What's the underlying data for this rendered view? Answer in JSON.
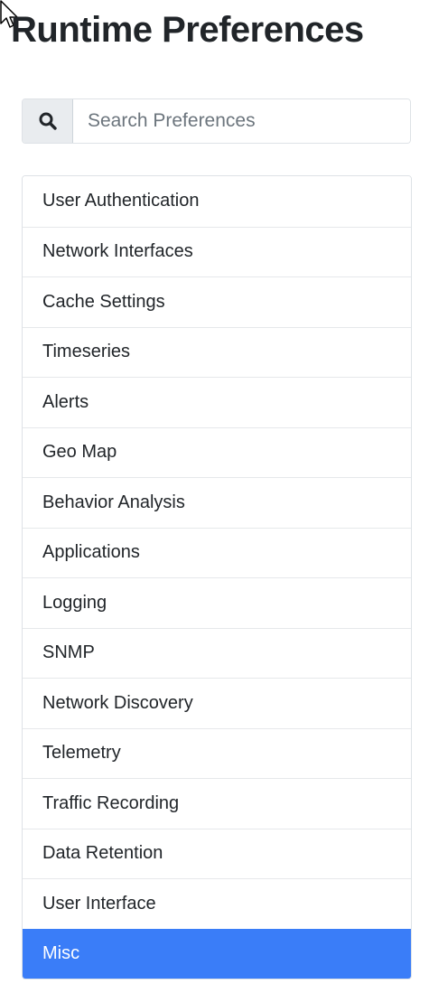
{
  "page": {
    "title": "Runtime Preferences"
  },
  "search": {
    "icon": "search-icon",
    "placeholder": "Search Preferences",
    "value": ""
  },
  "preferences": {
    "active_item": "Misc",
    "items": [
      {
        "label": "User Authentication"
      },
      {
        "label": "Network Interfaces"
      },
      {
        "label": "Cache Settings"
      },
      {
        "label": "Timeseries"
      },
      {
        "label": "Alerts"
      },
      {
        "label": "Geo Map"
      },
      {
        "label": "Behavior Analysis"
      },
      {
        "label": "Applications"
      },
      {
        "label": "Logging"
      },
      {
        "label": "SNMP"
      },
      {
        "label": "Network Discovery"
      },
      {
        "label": "Telemetry"
      },
      {
        "label": "Traffic Recording"
      },
      {
        "label": "Data Retention"
      },
      {
        "label": "User Interface"
      },
      {
        "label": "Misc"
      }
    ]
  },
  "colors": {
    "active_background": "#3a7df8",
    "addon_background": "#e9ecef",
    "text": "#212529"
  }
}
